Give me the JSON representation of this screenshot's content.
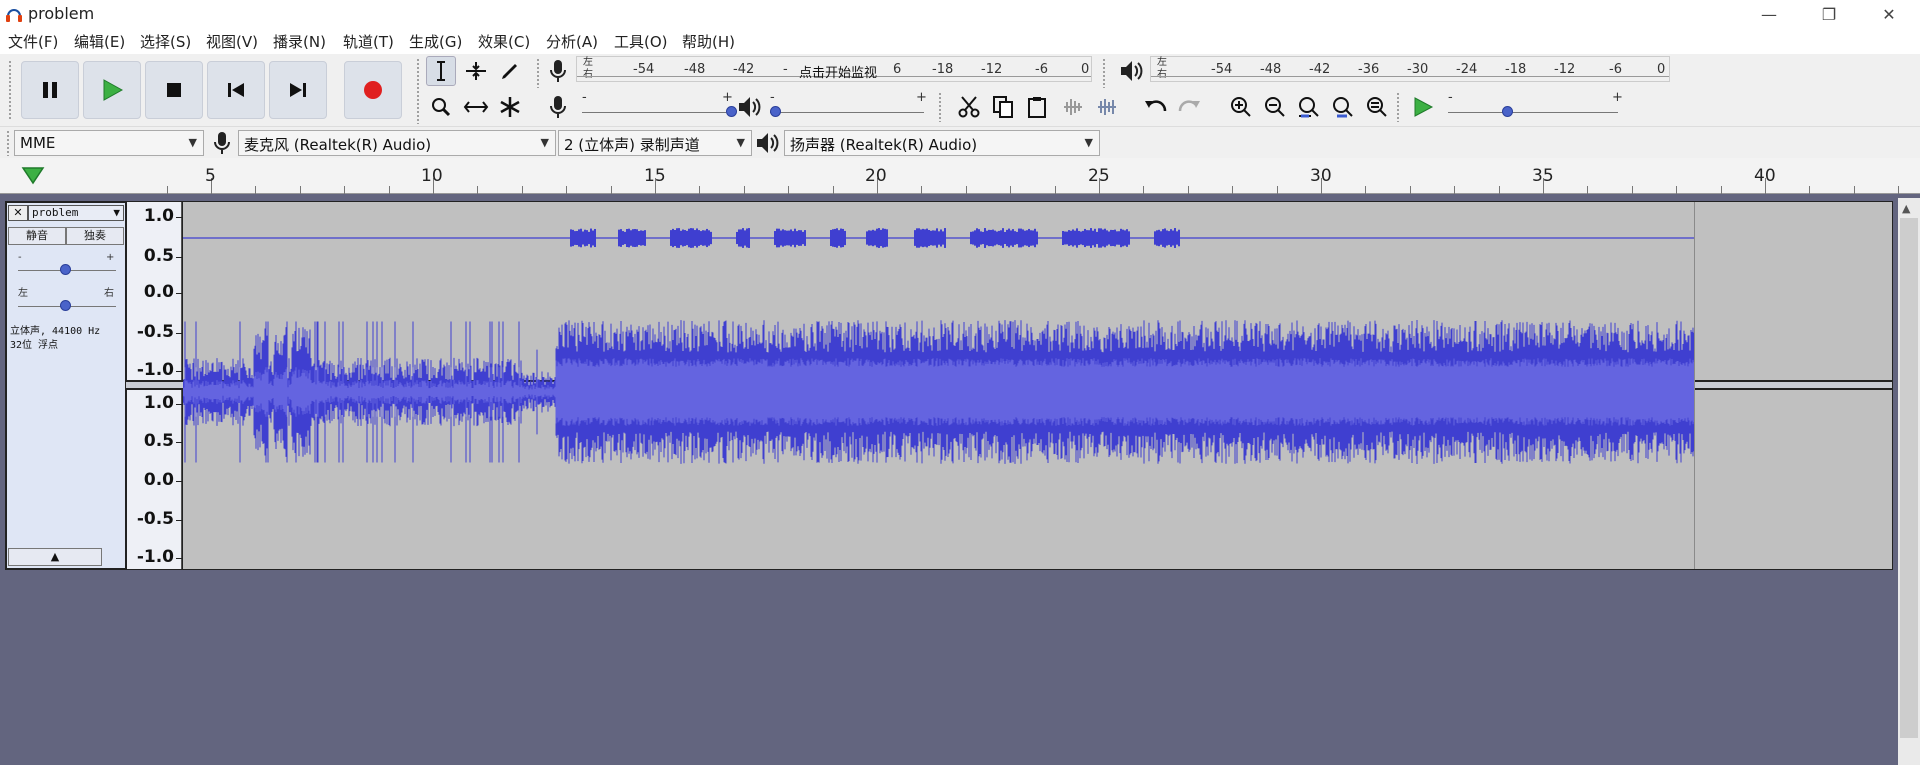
{
  "window": {
    "title": "problem",
    "minimize": "—",
    "restore": "❐",
    "close": "✕"
  },
  "menu": [
    "文件(F)",
    "编辑(E)",
    "选择(S)",
    "视图(V)",
    "播录(N)",
    "轨道(T)",
    "生成(G)",
    "效果(C)",
    "分析(A)",
    "工具(O)",
    "帮助(H)"
  ],
  "transport": [
    "pause-button",
    "play-button",
    "stop-button",
    "skip-start-button",
    "skip-end-button",
    "record-button"
  ],
  "meters": {
    "record_ticks": [
      "-54",
      "-48",
      "-42",
      "-",
      "6",
      "0"
    ],
    "record_hint": "点击开始监视",
    "play_ticks": [
      "-54",
      "-48",
      "-42",
      "-36",
      "-30",
      "-24",
      "-18",
      "-12",
      "-6",
      "0"
    ],
    "record_ticks_right": [
      "-18",
      "-12",
      "-6"
    ],
    "left": "左",
    "right": "右",
    "minus": "-",
    "plus": "+"
  },
  "devices": {
    "host": "MME",
    "mic": "麦克风 (Realtek(R) Audio)",
    "channels": "2 (立体声) 录制声道",
    "speaker": "扬声器 (Realtek(R) Audio)"
  },
  "ruler": [
    "5",
    "10",
    "15",
    "20",
    "25",
    "30",
    "35",
    "40"
  ],
  "track": {
    "name": "problem",
    "mute": "静音",
    "solo": "独奏",
    "gain_minus": "-",
    "gain_plus": "+",
    "pan_left": "左",
    "pan_right": "右",
    "info_line1": "立体声, 44100 Hz",
    "info_line2": "32位 浮点",
    "collapse": "▲",
    "close": "✕",
    "dropdown": "▼"
  },
  "vruler_labels": [
    "1.0",
    "0.5",
    "0.0",
    "-0.5",
    "-1.0"
  ],
  "colors": {
    "wave": "#3f3fd0",
    "wave_rms": "#6464e0",
    "track_bg": "#c0c0c0",
    "workspace": "#63657f",
    "record": "#e02020",
    "play": "#3cb043"
  }
}
